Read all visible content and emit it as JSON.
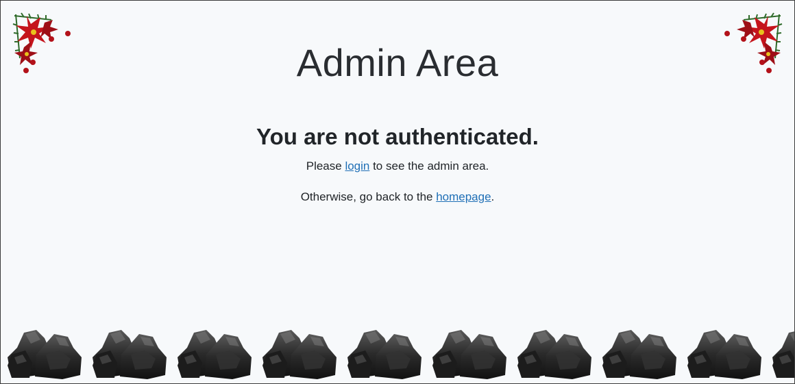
{
  "page": {
    "title": "Admin Area",
    "heading": "You are not authenticated.",
    "line1_before": "Please ",
    "login_link": "login",
    "line1_after": " to see the admin area.",
    "line2_before": "Otherwise, go back to the ",
    "homepage_link": "homepage",
    "line2_after": "."
  },
  "decor": {
    "corner_icon": "poinsettia-garland-icon",
    "coal_icon": "coal-lump-icon",
    "coal_count": 10
  },
  "colors": {
    "link": "#1f6fb6",
    "background": "#f7f9fb",
    "text": "#212529"
  }
}
